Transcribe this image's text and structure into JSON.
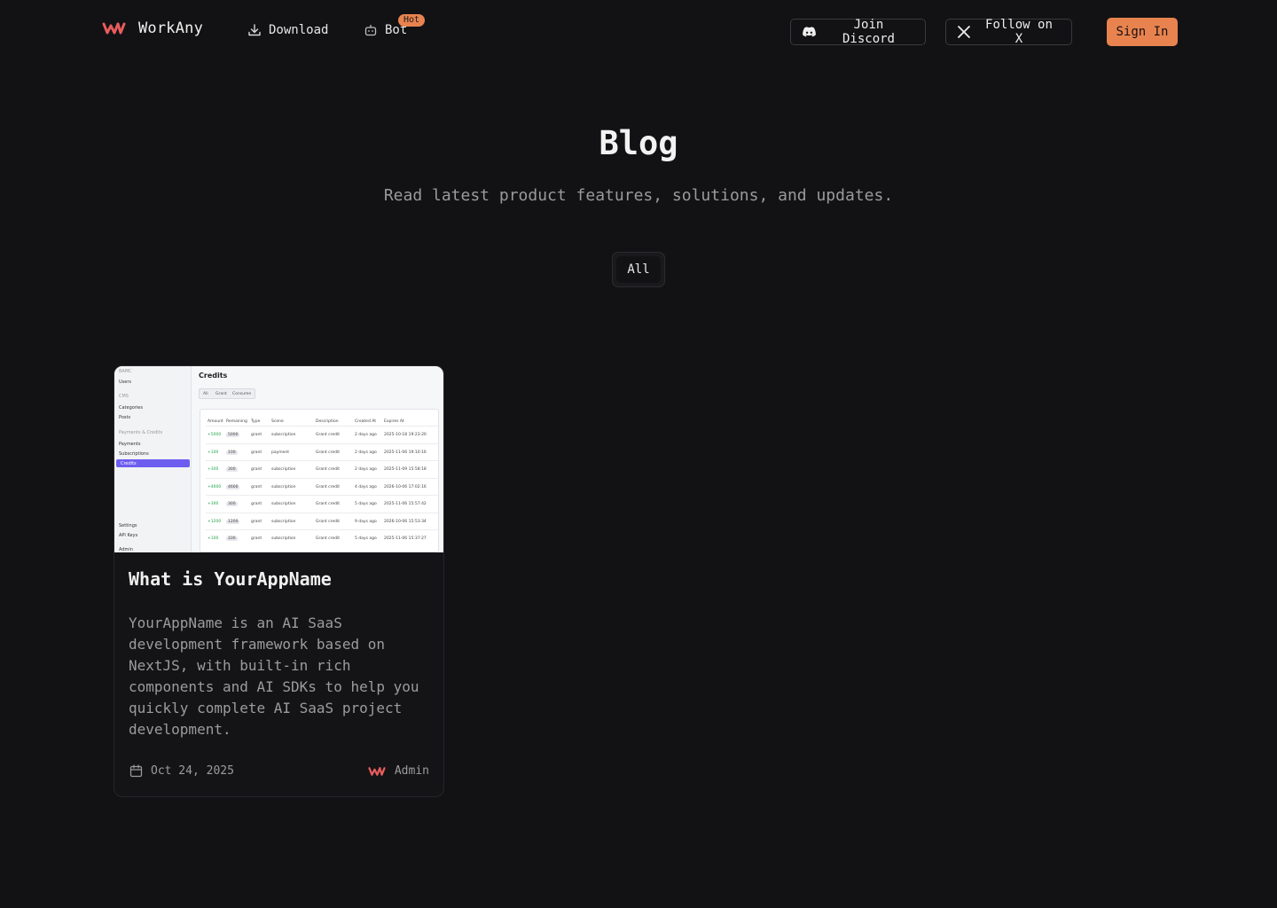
{
  "brand": {
    "name": "WorkAny",
    "accent_color": "#e8834f",
    "logo_color": "#e85c5c",
    "logo_icon": "workany-logo-icon"
  },
  "nav": {
    "download_label": "Download",
    "download_icon": "download-icon",
    "bot_label": "Bot",
    "bot_icon": "bot-icon",
    "bot_badge": "Hot"
  },
  "actions": {
    "discord_label": "Join Discord",
    "discord_icon": "discord-icon",
    "x_label": "Follow on X",
    "x_icon": "x-logo-icon",
    "sign_in_label": "Sign In"
  },
  "hero": {
    "title": "Blog",
    "subtitle": "Read latest product features, solutions, and updates."
  },
  "filters": {
    "active": "All"
  },
  "posts": [
    {
      "title": "What is YourAppName",
      "description": "YourAppName is an AI SaaS development framework based on NextJS, with built-in rich components and AI SDKs to help you quickly complete AI SaaS project development.",
      "date": "Oct 24, 2025",
      "author": "Admin",
      "thumbnail": {
        "sidebar": [
          {
            "text": "BAMC",
            "head": true
          },
          {
            "text": "Users"
          },
          {
            "text": "CMS",
            "head": true
          },
          {
            "text": "Categories"
          },
          {
            "text": "Posts"
          },
          {
            "text": "Payments & Credits",
            "head": true
          },
          {
            "text": "Payments"
          },
          {
            "text": "Subscriptions"
          },
          {
            "text": "Settings"
          },
          {
            "text": "API Keys"
          },
          {
            "text": "Admin"
          }
        ],
        "active_item": "Credits",
        "page_title": "Credits",
        "tabs": [
          "All",
          "Grant",
          "Consume"
        ],
        "columns": [
          "Amount",
          "Remaining",
          "Type",
          "Scene",
          "Description",
          "Created At",
          "Expires At"
        ],
        "rows": [
          [
            "+5000",
            "5000",
            "grant",
            "subscription",
            "Grant credit",
            "2 days ago",
            "2025-10-18 19:23:20"
          ],
          [
            "+100",
            "100",
            "grant",
            "payment",
            "Grant credit",
            "2 days ago",
            "2025-11-06 19:10:16"
          ],
          [
            "+300",
            "300",
            "grant",
            "subscription",
            "Grant credit",
            "2 days ago",
            "2025-11-09 15:58:18"
          ],
          [
            "+4600",
            "4600",
            "grant",
            "subscription",
            "Grant credit",
            "4 days ago",
            "2026-10-06 17:02:16"
          ],
          [
            "+300",
            "300",
            "grant",
            "subscription",
            "Grant credit",
            "5 days ago",
            "2025-11-06 15:57:42"
          ],
          [
            "+1200",
            "1200",
            "grant",
            "subscription",
            "Grant credit",
            "9 days ago",
            "2026-10-06 15:53:34"
          ],
          [
            "+100",
            "100",
            "grant",
            "subscription",
            "Grant credit",
            "5 days ago",
            "2025-11-06 15:37:27"
          ]
        ]
      }
    }
  ]
}
